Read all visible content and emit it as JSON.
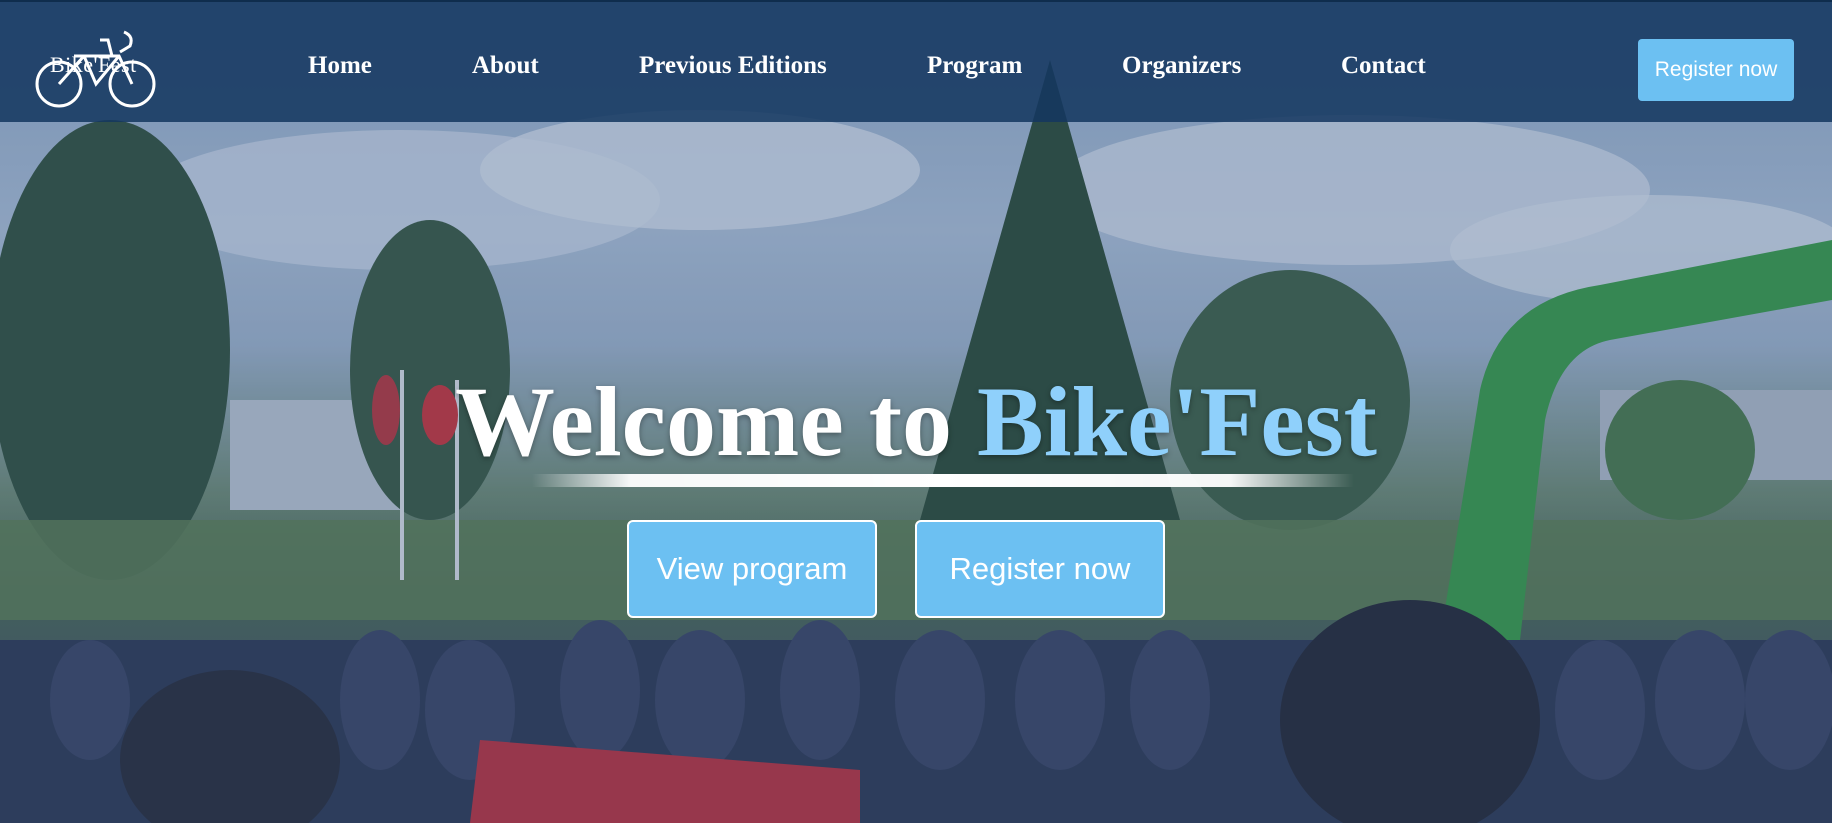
{
  "logo": {
    "text": "Bike'Fest",
    "icon": "bicycle-icon"
  },
  "nav": {
    "items": [
      {
        "label": "Home"
      },
      {
        "label": "About"
      },
      {
        "label": "Previous Editions"
      },
      {
        "label": "Program"
      },
      {
        "label": "Organizers"
      },
      {
        "label": "Contact"
      }
    ],
    "register_label": "Register now"
  },
  "hero": {
    "title_part1": "Welcome to",
    "title_part2": "Bike'Fest",
    "view_program_label": "View program",
    "register_label": "Register now"
  },
  "colors": {
    "navbar": "#14375f",
    "accent": "#6cc0f2",
    "title_highlight": "#8fd0fb"
  }
}
